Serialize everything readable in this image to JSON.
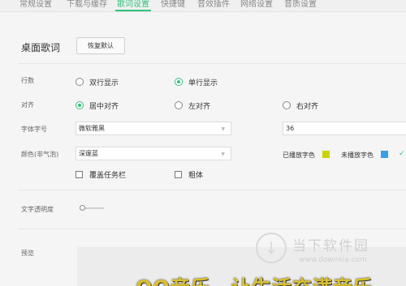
{
  "tabs": [
    {
      "label": "常规设置"
    },
    {
      "label": "下载与缓存"
    },
    {
      "label": "歌词设置"
    },
    {
      "label": "快捷键"
    },
    {
      "label": "音效插件"
    },
    {
      "label": "网络设置"
    },
    {
      "label": "音质设置"
    }
  ],
  "section": {
    "title": "桌面歌词",
    "reset_label": "恢复默认"
  },
  "rows": {
    "lines_label": "行数",
    "lines_options": [
      "双行显示",
      "单行显示"
    ],
    "align_label": "对齐",
    "align_options": [
      "居中对齐",
      "左对齐",
      "右对齐"
    ],
    "font_label": "字体字号",
    "font_value": "微软雅黑",
    "font_size_value": "36",
    "color_label": "颜色(非气泡)",
    "color_value": "深邃蓝",
    "played_label": "已播放字色",
    "unplayed_label": "未播放字色",
    "played_color": "#c8d400",
    "unplayed_color": "#3aa0e6",
    "cover_taskbar_label": "覆盖任务栏",
    "bold_label": "粗体",
    "opacity_label": "文字透明度",
    "opacity_value": 0.1,
    "preview_label": "预览",
    "preview_text": "QQ音乐，让生活充满音乐"
  },
  "watermark": {
    "title": "当下软件园",
    "url": "www.downxia.com"
  },
  "colors": {
    "accent": "#31c27c"
  }
}
